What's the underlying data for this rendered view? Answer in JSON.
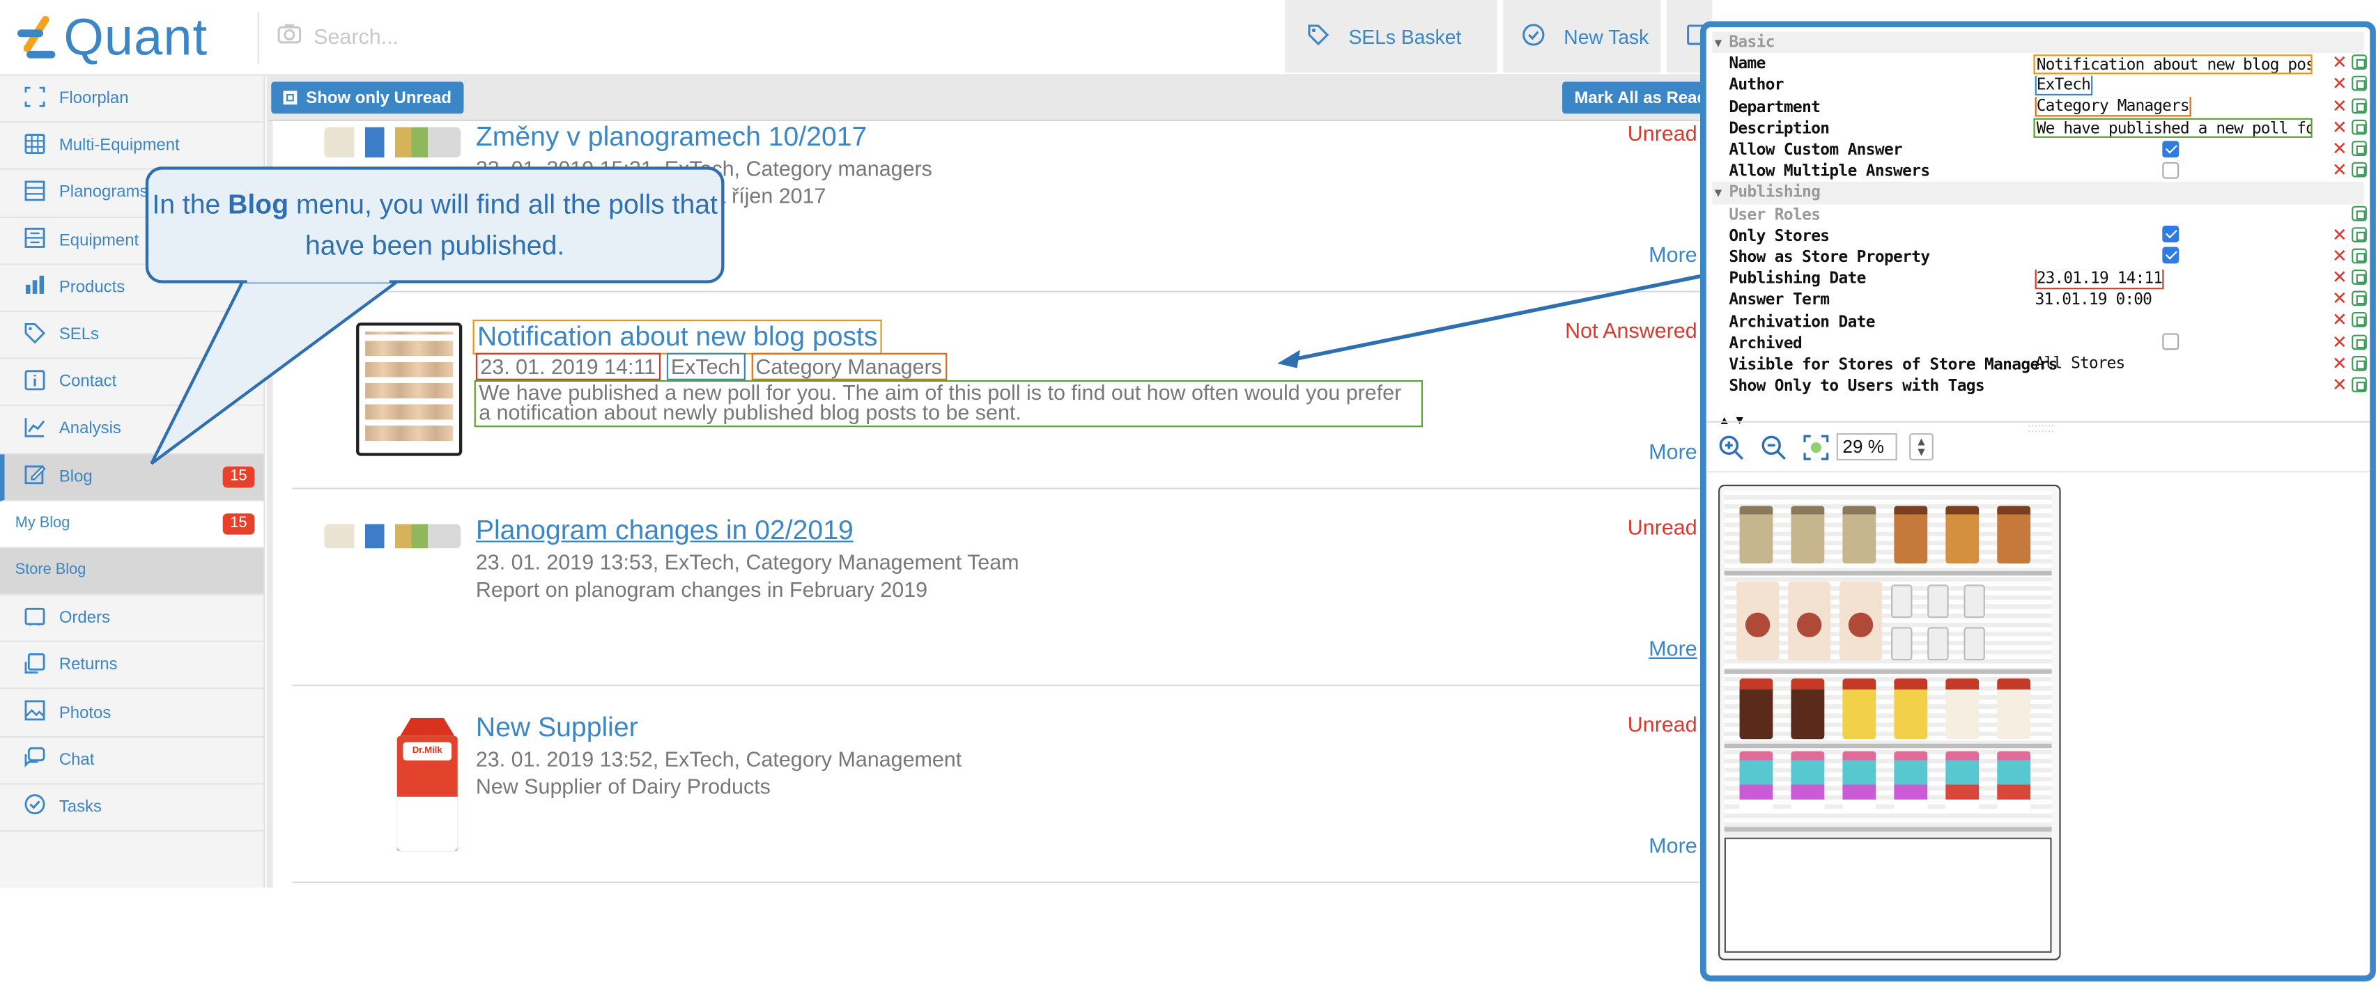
{
  "app": {
    "logo_text": "Quant",
    "brand_color": "#3b86c6"
  },
  "header": {
    "search_placeholder": "Search...",
    "buttons": [
      {
        "label": "SELs Basket",
        "icon": "tag-icon"
      },
      {
        "label": "New Task",
        "icon": "check-circle-icon"
      }
    ]
  },
  "sidebar": {
    "items": [
      {
        "label": "Floorplan",
        "icon": "floorplan-icon"
      },
      {
        "label": "Multi-Equipment",
        "icon": "multi-equipment-icon"
      },
      {
        "label": "Planograms",
        "icon": "planogram-icon"
      },
      {
        "label": "Equipment",
        "icon": "equipment-icon"
      },
      {
        "label": "Products",
        "icon": "products-icon"
      },
      {
        "label": "SELs",
        "icon": "tag-icon"
      },
      {
        "label": "Contact",
        "icon": "info-icon"
      },
      {
        "label": "Analysis",
        "icon": "chart-icon"
      },
      {
        "label": "Blog",
        "icon": "edit-icon",
        "badge": "15"
      },
      {
        "label": "My Blog",
        "badge": "15"
      },
      {
        "label": "Store Blog"
      },
      {
        "label": "Orders",
        "icon": "orders-icon"
      },
      {
        "label": "Returns",
        "icon": "returns-icon"
      },
      {
        "label": "Photos",
        "icon": "photo-icon"
      },
      {
        "label": "Chat",
        "icon": "chat-icon"
      },
      {
        "label": "Tasks",
        "icon": "check-circle-icon"
      }
    ]
  },
  "toolbar": {
    "show_unread_label": "Show only Unread",
    "mark_all_label": "Mark All as Read"
  },
  "posts": [
    {
      "title": "Změny v planogramech 10/2017",
      "meta": "23. 01. 2019 15:21, ExTech, Category managers",
      "desc": "Změny v planogramech za říjen 2017",
      "status": "Unread",
      "more": "More"
    },
    {
      "title": "Notification about new blog posts",
      "meta_date": "23. 01. 2019 14:11",
      "meta_author": "ExTech",
      "meta_dept": "Category Managers",
      "desc": "We have published a new poll for you. The aim of this poll is to find out how often would you prefer a notification about newly published blog posts to be sent.",
      "status": "Not Answered",
      "more": "More"
    },
    {
      "title": "Planogram changes in 02/2019",
      "meta": "23. 01. 2019 13:53, ExTech, Category Management Team",
      "desc": "Report on planogram changes in February 2019",
      "status": "Unread",
      "more": "More"
    },
    {
      "title": "New Supplier",
      "meta": "23. 01. 2019 13:52, ExTech, Category Management",
      "desc": "New Supplier of Dairy Products",
      "status": "Unread",
      "more": "More",
      "thumb_brand": "Dr.Milk"
    }
  ],
  "callout": {
    "prefix": "In the ",
    "bold": "Blog",
    "suffix": " menu, you will find all the polls that have been published."
  },
  "properties": {
    "groups": [
      {
        "name": "Basic"
      },
      {
        "name": "Publishing"
      }
    ],
    "rows": {
      "name": {
        "label": "Name",
        "value": "Notification about new blog posts"
      },
      "author": {
        "label": "Author",
        "value": "ExTech"
      },
      "department": {
        "label": "Department",
        "value": "Category Managers"
      },
      "description": {
        "label": "Description",
        "value": "We have published a new poll fo..."
      },
      "allow_custom": {
        "label": "Allow Custom Answer",
        "checked": true
      },
      "allow_multiple": {
        "label": "Allow Multiple Answers",
        "checked": false
      },
      "user_roles": {
        "label": "User Roles"
      },
      "only_stores": {
        "label": "Only Stores",
        "checked": true
      },
      "show_store_prop": {
        "label": "Show as Store Property",
        "checked": true
      },
      "publishing_date": {
        "label": "Publishing Date",
        "value": "23.01.19 14:11"
      },
      "answer_term": {
        "label": "Answer Term",
        "value": "31.01.19 0:00"
      },
      "archivation_date": {
        "label": "Archivation Date"
      },
      "archived": {
        "label": "Archived",
        "checked": false
      },
      "visible_for": {
        "label": "Visible for Stores of Store Managers",
        "value": "All Stores"
      },
      "show_only_tags": {
        "label": "Show Only to Users with Tags"
      }
    }
  },
  "viewer": {
    "zoom": "29 %"
  }
}
